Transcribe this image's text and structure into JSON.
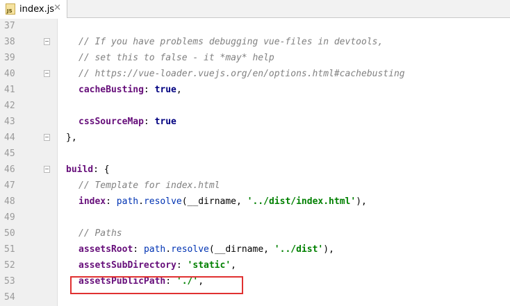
{
  "tab": {
    "filename": "index.js",
    "icon_text": "JS",
    "close": "✕"
  },
  "lines": [
    {
      "num": "37",
      "indent": 0,
      "parts": []
    },
    {
      "num": "38",
      "indent": 2,
      "parts": [
        {
          "t": "cmt",
          "v": "// If you have problems debugging vue-files in devtools,"
        }
      ]
    },
    {
      "num": "39",
      "indent": 2,
      "parts": [
        {
          "t": "cmt",
          "v": "// set this to false - it *may* help"
        }
      ]
    },
    {
      "num": "40",
      "indent": 2,
      "parts": [
        {
          "t": "cmt",
          "v": "// https://vue-loader.vuejs.org/en/options.html#cachebusting"
        }
      ]
    },
    {
      "num": "41",
      "indent": 2,
      "parts": [
        {
          "t": "key",
          "v": "cacheBusting"
        },
        {
          "t": "plain",
          "v": ": "
        },
        {
          "t": "kw",
          "v": "true"
        },
        {
          "t": "plain",
          "v": ","
        }
      ]
    },
    {
      "num": "42",
      "indent": 0,
      "parts": []
    },
    {
      "num": "43",
      "indent": 2,
      "parts": [
        {
          "t": "key",
          "v": "cssSourceMap"
        },
        {
          "t": "plain",
          "v": ": "
        },
        {
          "t": "kw",
          "v": "true"
        }
      ]
    },
    {
      "num": "44",
      "indent": 1,
      "parts": [
        {
          "t": "plain",
          "v": "},"
        }
      ]
    },
    {
      "num": "45",
      "indent": 0,
      "parts": []
    },
    {
      "num": "46",
      "indent": 1,
      "parts": [
        {
          "t": "key",
          "v": "build"
        },
        {
          "t": "plain",
          "v": ": {"
        }
      ]
    },
    {
      "num": "47",
      "indent": 2,
      "parts": [
        {
          "t": "cmt",
          "v": "// Template for index.html"
        }
      ]
    },
    {
      "num": "48",
      "indent": 2,
      "parts": [
        {
          "t": "key",
          "v": "index"
        },
        {
          "t": "plain",
          "v": ": "
        },
        {
          "t": "fn",
          "v": "path"
        },
        {
          "t": "plain",
          "v": "."
        },
        {
          "t": "fn",
          "v": "resolve"
        },
        {
          "t": "plain",
          "v": "(__dirname, "
        },
        {
          "t": "str",
          "v": "'../dist/index.html'"
        },
        {
          "t": "plain",
          "v": "),"
        }
      ]
    },
    {
      "num": "49",
      "indent": 0,
      "parts": []
    },
    {
      "num": "50",
      "indent": 2,
      "parts": [
        {
          "t": "cmt",
          "v": "// Paths"
        }
      ]
    },
    {
      "num": "51",
      "indent": 2,
      "parts": [
        {
          "t": "key",
          "v": "assetsRoot"
        },
        {
          "t": "plain",
          "v": ": "
        },
        {
          "t": "fn",
          "v": "path"
        },
        {
          "t": "plain",
          "v": "."
        },
        {
          "t": "fn",
          "v": "resolve"
        },
        {
          "t": "plain",
          "v": "(__dirname, "
        },
        {
          "t": "str",
          "v": "'../dist'"
        },
        {
          "t": "plain",
          "v": "),"
        }
      ]
    },
    {
      "num": "52",
      "indent": 2,
      "parts": [
        {
          "t": "key",
          "v": "assetsSubDirectory"
        },
        {
          "t": "plain",
          "v": ": "
        },
        {
          "t": "str",
          "v": "'static'"
        },
        {
          "t": "plain",
          "v": ","
        }
      ]
    },
    {
      "num": "53",
      "indent": 2,
      "parts": [
        {
          "t": "key",
          "v": "assetsPublicPath"
        },
        {
          "t": "plain",
          "v": ": "
        },
        {
          "t": "str",
          "v": "'./'"
        },
        {
          "t": "plain",
          "v": ","
        }
      ]
    },
    {
      "num": "54",
      "indent": 0,
      "parts": []
    }
  ],
  "fold_markers": [
    "38",
    "40",
    "44",
    "46"
  ],
  "highlighted_line": "53",
  "colors": {
    "highlight_border": "#e03131",
    "comment": "#808080",
    "property": "#660e7a",
    "keyword": "#000080",
    "string": "#008000"
  }
}
